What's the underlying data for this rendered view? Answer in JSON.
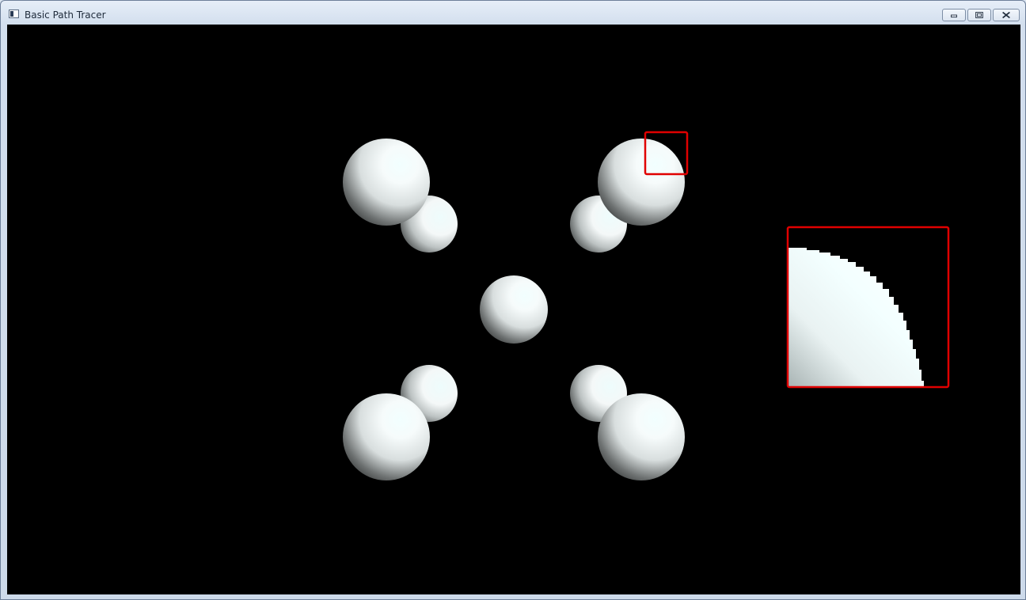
{
  "window": {
    "title": "Basic Path Tracer"
  },
  "controls": {
    "minimize_icon": "minimize-icon",
    "maximize_icon": "restore-icon",
    "close_icon": "close-icon"
  },
  "scene": {
    "background": "#000000",
    "sphere_color": "#ffffff",
    "highlight_box_color": "#e00000"
  }
}
